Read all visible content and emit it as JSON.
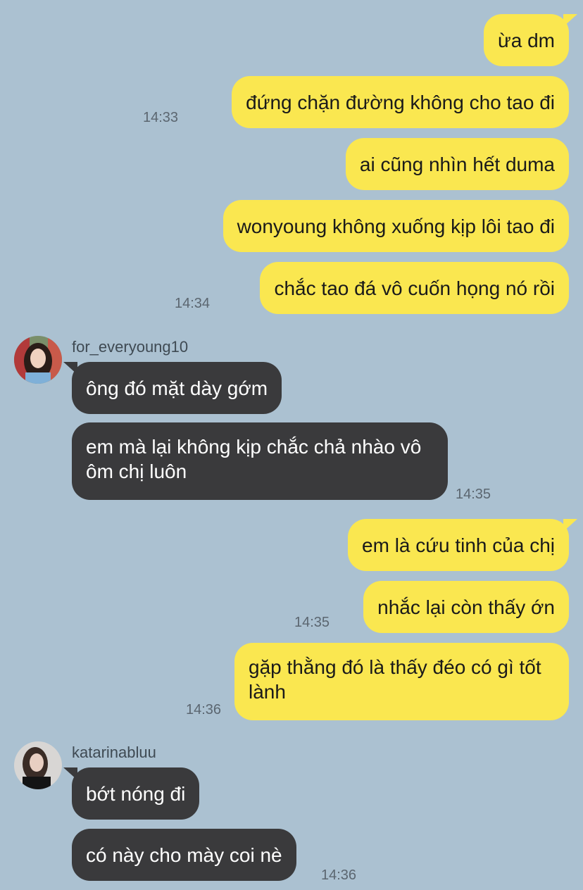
{
  "messages": {
    "out1": "ừa dm",
    "out2": "đứng chặn đường không cho tao đi",
    "out3": "ai cũng nhìn hết duma",
    "out4": "wonyoung không xuống kịp lôi tao đi",
    "out5": "chắc tao đá vô cuốn họng nó rồi",
    "in1": "ông đó mặt dày gớm",
    "in2": "em mà lại không kịp chắc chả nhào vô ôm chị luôn",
    "out6": "em là cứu tinh của chị",
    "out7": "nhắc lại còn thấy ớn",
    "out8": "gặp thằng đó là thấy đéo có gì tốt lành",
    "in3": "bớt nóng đi",
    "in4": "có này cho mày coi nè"
  },
  "times": {
    "t1": "14:33",
    "t2": "14:34",
    "t3": "14:35",
    "t4": "14:35",
    "t5": "14:36",
    "t6": "14:36"
  },
  "senders": {
    "s1": "for_everyoung10",
    "s2": "katarinabluu"
  },
  "colors": {
    "background": "#abc1d1",
    "outgoing_bubble": "#fae750",
    "incoming_bubble": "#3a3a3c"
  }
}
